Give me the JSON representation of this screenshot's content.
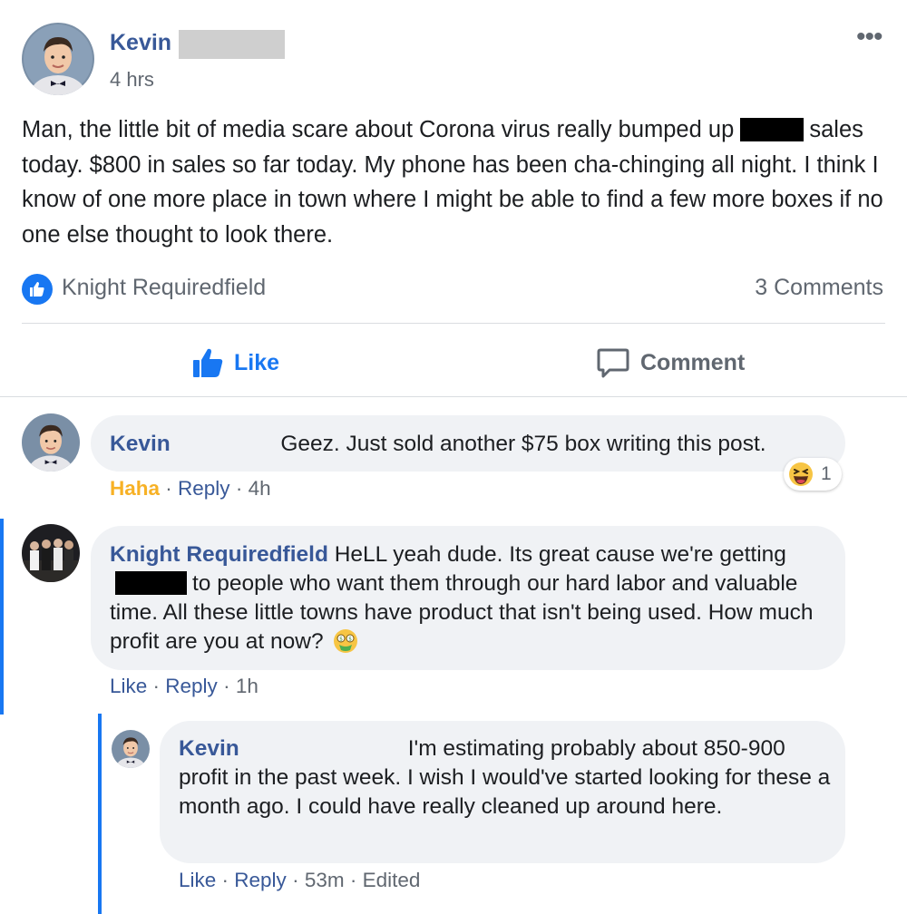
{
  "post": {
    "author": "Kevin",
    "time": "4 hrs",
    "more_label": "•••",
    "text_line1": "Man, the little bit of media scare about Corona virus really bumped up",
    "text_rest": "sales today. $800 in sales so far today. My phone has been cha-chinging all night. I think I know of one more place in town where I might be able to find a few more boxes if no one else thought to look there.",
    "reactor_name": "Knight Requiredfield",
    "comments_count": "3 Comments",
    "like_label": "Like",
    "comment_label": "Comment"
  },
  "comments": [
    {
      "author": "Kevin",
      "text": "Geez. Just sold another $75 box writing this post.",
      "reaction_label": "Haha",
      "reply_label": "Reply",
      "time": "4h",
      "reaction_count": "1"
    },
    {
      "author": "Knight Requiredfield",
      "text_a": "HeLL yeah dude. Its great cause we're getting",
      "text_b": "to people who want them through our hard labor and valuable time. All these little towns have product that isn't being used. How much profit are you at now?",
      "like_label": "Like",
      "reply_label": "Reply",
      "time": "1h"
    },
    {
      "author": "Kevin",
      "text": "I'm estimating probably about 850-900 profit in the past week. I wish I would've started looking for these a month ago. I could have really cleaned up around here.",
      "like_label": "Like",
      "reply_label": "Reply",
      "time": "53m",
      "edited_label": "Edited"
    }
  ],
  "colors": {
    "link_blue": "#385898",
    "fb_blue": "#1877f2",
    "haha_orange": "#f7b125",
    "bubble_bg": "#f0f2f5",
    "meta_gray": "#606770"
  },
  "icons": [
    "kid-avatar-icon",
    "group-photo-avatar-icon",
    "like-thumb-icon",
    "comment-bubble-icon",
    "haha-emoji-icon",
    "money-mouth-emoji-icon"
  ]
}
